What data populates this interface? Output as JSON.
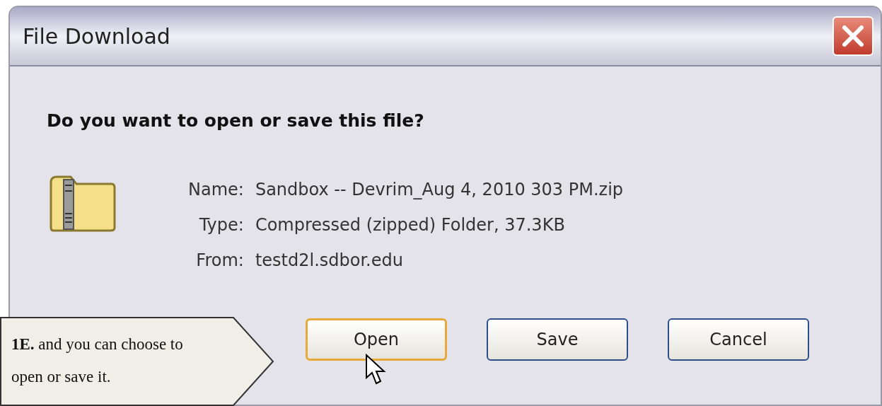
{
  "window": {
    "title": "File Download"
  },
  "question": "Do you want to open or save this file?",
  "fields": [
    {
      "label": "Name:",
      "value": "Sandbox -- Devrim_Aug 4, 2010 303 PM.zip"
    },
    {
      "label": "Type:",
      "value": "Compressed (zipped) Folder, 37.3KB"
    },
    {
      "label": "From:",
      "value": "testd2l.sdbor.edu"
    }
  ],
  "buttons": [
    {
      "label": "Open",
      "default": true
    },
    {
      "label": "Save",
      "default": false
    },
    {
      "label": "Cancel",
      "default": false
    }
  ],
  "callout": {
    "text": "**1E.** and you can choose to open or save it."
  }
}
